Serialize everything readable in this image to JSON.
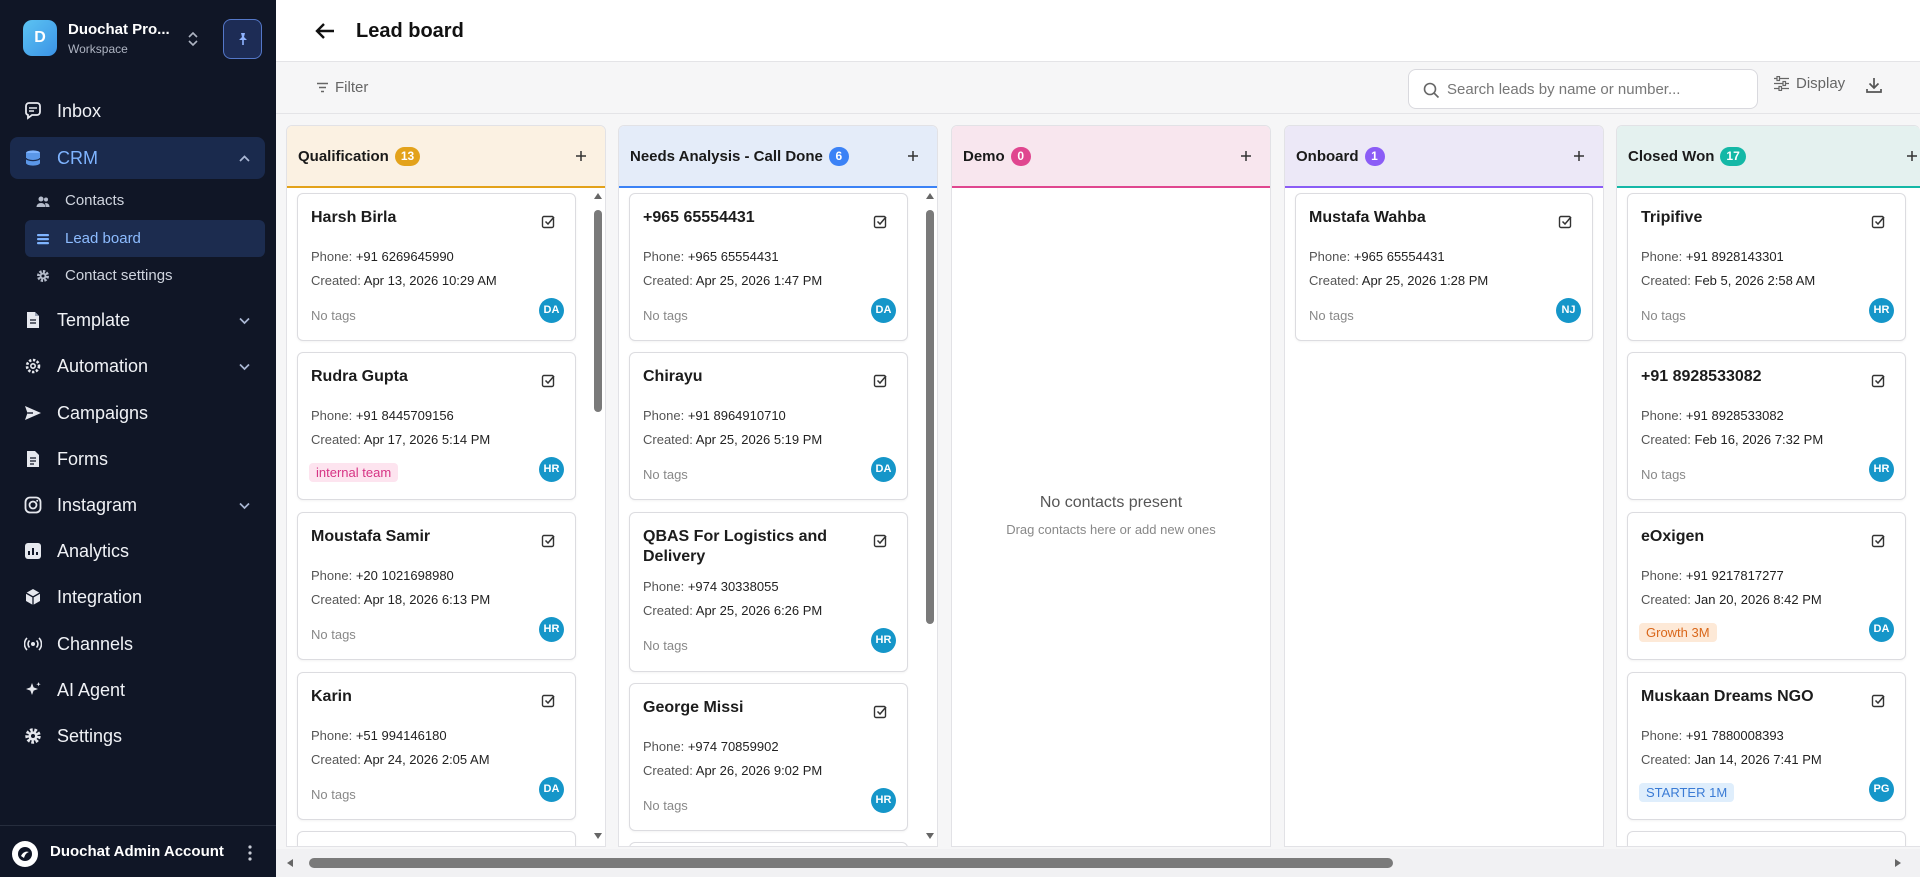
{
  "workspace": {
    "initial": "D",
    "name": "Duochat Pro...",
    "subtitle": "Workspace"
  },
  "nav": {
    "inbox": "Inbox",
    "crm": "CRM",
    "crm_sub": {
      "contacts": "Contacts",
      "lead_board": "Lead board",
      "contact_settings": "Contact settings"
    },
    "template": "Template",
    "automation": "Automation",
    "campaigns": "Campaigns",
    "forms": "Forms",
    "instagram": "Instagram",
    "analytics": "Analytics",
    "integration": "Integration",
    "channels": "Channels",
    "ai_agent": "AI Agent",
    "settings": "Settings"
  },
  "account": {
    "name": "Duochat Admin Account"
  },
  "header": {
    "title": "Lead board"
  },
  "toolbar": {
    "filter": "Filter",
    "search_placeholder": "Search leads by name or number...",
    "display": "Display"
  },
  "labels": {
    "phone": "Phone:",
    "created": "Created:",
    "no_tags": "No tags"
  },
  "columns": [
    {
      "title": "Qualification",
      "count": "13",
      "color": "#e3a21a",
      "head_bg": "#fbf1e2",
      "cards": [
        {
          "name": "Harsh Birla",
          "phone": "+91 6269645990",
          "created": "Apr 13, 2026 10:29 AM",
          "tag": "",
          "owner": "DA"
        },
        {
          "name": "Rudra Gupta",
          "phone": "+91 8445709156",
          "created": "Apr 17, 2026 5:14 PM",
          "tag": "internal team",
          "owner": "HR"
        },
        {
          "name": "Moustafa Samir",
          "phone": "+20 1021698980",
          "created": "Apr 18, 2026 6:13 PM",
          "tag": "",
          "owner": "HR"
        },
        {
          "name": "Karin",
          "phone": "+51 994146180",
          "created": "Apr 24, 2026 2:05 AM",
          "tag": "",
          "owner": "DA"
        }
      ]
    },
    {
      "title": "Needs Analysis - Call Done",
      "count": "6",
      "color": "#3b82f6",
      "head_bg": "#e4ecf9",
      "cards": [
        {
          "name": "+965 65554431",
          "phone": "+965 65554431",
          "created": "Apr 25, 2026 1:47 PM",
          "tag": "",
          "owner": "DA"
        },
        {
          "name": "Chirayu",
          "phone": "+91 8964910710",
          "created": "Apr 25, 2026 5:19 PM",
          "tag": "",
          "owner": "DA"
        },
        {
          "name": "QBAS For Logistics and Delivery",
          "phone": "+974 30338055",
          "created": "Apr 25, 2026 6:26 PM",
          "tag": "",
          "owner": "HR"
        },
        {
          "name": "George Missi",
          "phone": "+974 70859902",
          "created": "Apr 26, 2026 9:02 PM",
          "tag": "",
          "owner": "HR"
        }
      ]
    },
    {
      "title": "Demo",
      "count": "0",
      "color": "#e0468f",
      "head_bg": "#f8e6ee",
      "empty_title": "No contacts present",
      "empty_sub": "Drag contacts here or add new ones",
      "cards": []
    },
    {
      "title": "Onboard",
      "count": "1",
      "color": "#8b5cf6",
      "head_bg": "#ece8f7",
      "cards": [
        {
          "name": "Mustafa Wahba",
          "phone": "+965 65554431",
          "created": "Apr 25, 2026 1:28 PM",
          "tag": "",
          "owner": "NJ"
        }
      ]
    },
    {
      "title": "Closed Won",
      "count": "17",
      "color": "#14b8a6",
      "head_bg": "#e4f1ef",
      "cards": [
        {
          "name": "Tripifive",
          "phone": "+91 8928143301",
          "created": "Feb 5, 2026 2:58 AM",
          "tag": "",
          "owner": "HR"
        },
        {
          "name": "+91 8928533082",
          "phone": "+91 8928533082",
          "created": "Feb 16, 2026 7:32 PM",
          "tag": "",
          "owner": "HR"
        },
        {
          "name": "eOxigen",
          "phone": "+91 9217817277",
          "created": "Jan 20, 2026 8:42 PM",
          "tag": "Growth 3M",
          "owner": "DA"
        },
        {
          "name": "Muskaan Dreams NGO",
          "phone": "+91 7880008393",
          "created": "Jan 14, 2026 7:41 PM",
          "tag": "STARTER 1M",
          "owner": "PG"
        }
      ]
    }
  ],
  "tag_colors": {
    "internal team": {
      "bg": "#fde4ef",
      "fg": "#d63384"
    },
    "Growth 3M": {
      "bg": "#fde9d7",
      "fg": "#d9671a"
    },
    "STARTER 1M": {
      "bg": "#dfeefc",
      "fg": "#3a7bd5"
    }
  },
  "owner_colors": {
    "DA": "#1596c9",
    "HR": "#1596c9",
    "NJ": "#1596c9",
    "PG": "#1596c9"
  }
}
